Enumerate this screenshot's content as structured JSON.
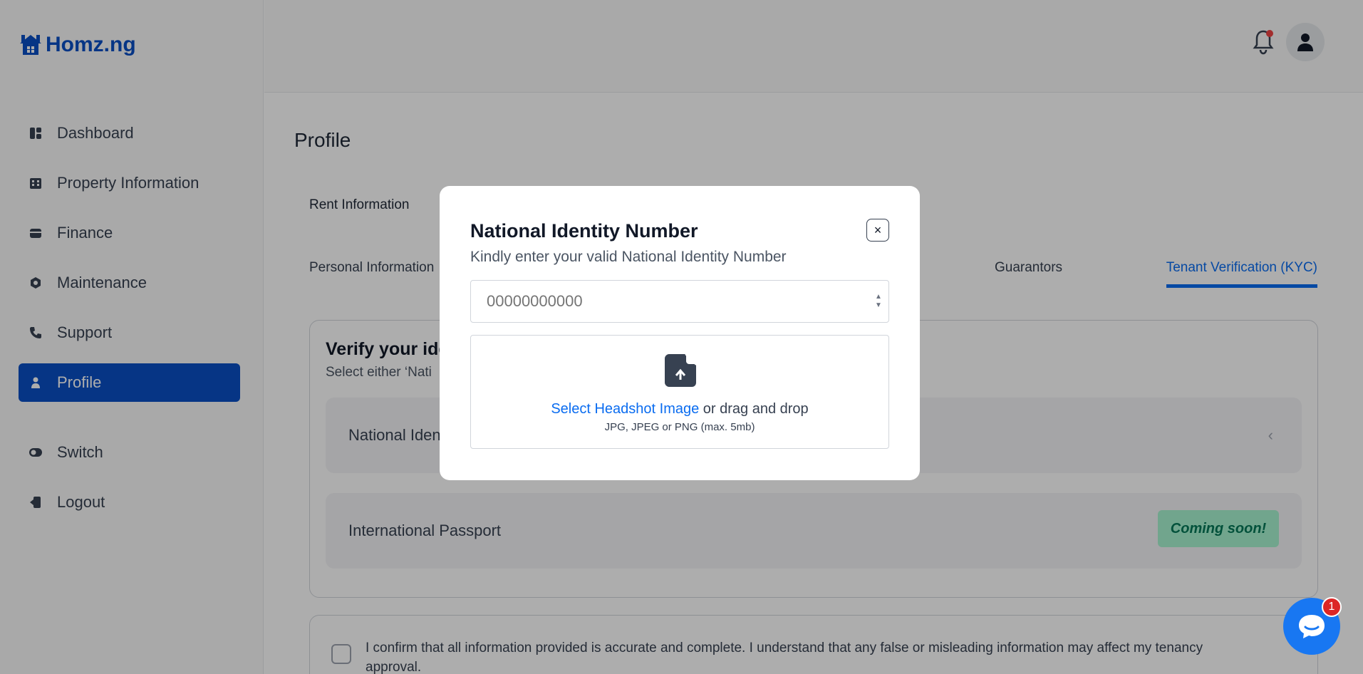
{
  "brand": {
    "name": "Homz.ng",
    "color": "#0a4fc4"
  },
  "sidebar": {
    "items": [
      {
        "label": "Dashboard",
        "icon": "dashboard-icon"
      },
      {
        "label": "Property Information",
        "icon": "building-icon"
      },
      {
        "label": "Finance",
        "icon": "wallet-icon"
      },
      {
        "label": "Maintenance",
        "icon": "wrench-icon"
      },
      {
        "label": "Support",
        "icon": "phone-icon"
      },
      {
        "label": "Profile",
        "icon": "user-icon",
        "active": true
      }
    ],
    "secondary": [
      {
        "label": "Switch",
        "icon": "switch-icon"
      },
      {
        "label": "Logout",
        "icon": "logout-icon"
      }
    ]
  },
  "header": {
    "notification_icon": "bell-icon",
    "avatar_icon": "user-icon"
  },
  "main": {
    "title": "Profile",
    "rent_tab": "Rent Information",
    "tabs": [
      {
        "label": "Personal Information"
      },
      {
        "label": "Guarantors"
      },
      {
        "label": "Tenant Verification (KYC)",
        "active": true
      }
    ],
    "kyc": {
      "title": "Verify your ide",
      "subtitle": "Select either ‘Nati",
      "option_nin": "National Iden",
      "option_passport": "International Passport",
      "coming_soon": "Coming soon!"
    },
    "confirm_text": "I confirm that all information provided is accurate and complete. I understand that any false or misleading information may affect my tenancy approval."
  },
  "modal": {
    "title": "National Identity Number",
    "subtitle": "Kindly enter your valid National Identity Number",
    "close": "×",
    "input_placeholder": "00000000000",
    "upload_link": "Select Headshot Image",
    "upload_text": " or drag and drop",
    "upload_hint": "JPG, JPEG or PNG (max. 5mb)"
  },
  "chat": {
    "badge": "1"
  }
}
